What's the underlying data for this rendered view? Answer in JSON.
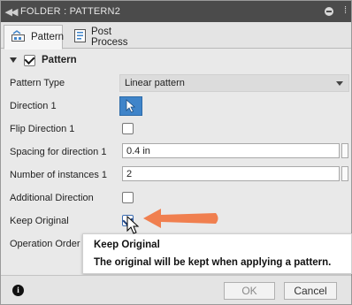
{
  "titlebar": {
    "collapse_icon": "double-left-arrow",
    "title": "FOLDER : PATTERN2",
    "menu_icon": "⁞"
  },
  "tabs": [
    {
      "label": "Pattern",
      "icon": "pattern-tab-icon",
      "active": true
    },
    {
      "label": "Post Process",
      "icon": "post-process-tab-icon",
      "active": false
    }
  ],
  "section": {
    "title": "Pattern",
    "checked": true
  },
  "fields": {
    "pattern_type": {
      "label": "Pattern Type",
      "value": "Linear pattern"
    },
    "direction1": {
      "label": "Direction 1"
    },
    "flip_direction1": {
      "label": "Flip Direction 1",
      "checked": false
    },
    "spacing": {
      "label": "Spacing for direction 1",
      "value": "0.4 in"
    },
    "instances": {
      "label": "Number of instances 1",
      "value": "2"
    },
    "additional_direction": {
      "label": "Additional Direction",
      "checked": false
    },
    "keep_original": {
      "label": "Keep Original",
      "checked": true
    },
    "operation_order": {
      "label": "Operation Order"
    }
  },
  "tooltip": {
    "title": "Keep Original",
    "body": "The original will be kept when applying a pattern."
  },
  "footer": {
    "info_label": "i",
    "ok_label": "OK",
    "cancel_label": "Cancel"
  },
  "colors": {
    "titlebar_bg": "#4b4b4b",
    "accent_blue": "#3f84c9",
    "annotation_arrow": "#f07f4f"
  }
}
